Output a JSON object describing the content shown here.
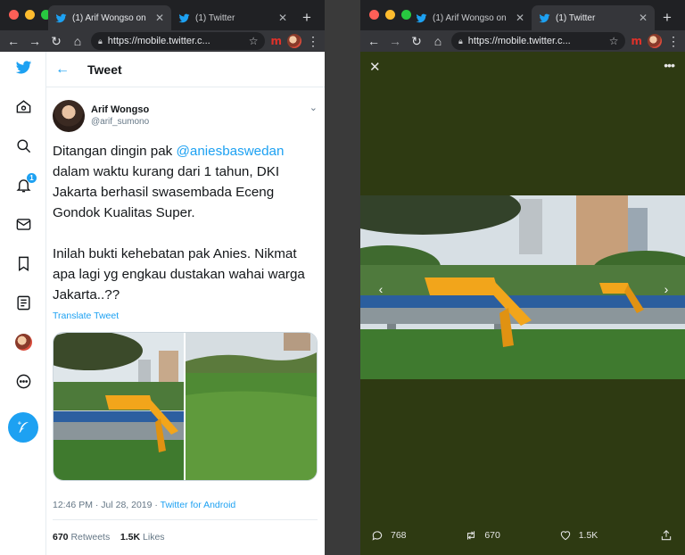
{
  "browser": {
    "tab1_title": "(1) Arif Wongso on",
    "tab2_title": "(1) Twitter",
    "url": "https://mobile.twitter.c..."
  },
  "colors": {
    "twitter_blue": "#1da1f2",
    "viewer_bg": "#2e3a12"
  },
  "left": {
    "header_title": "Tweet",
    "notification_count": "1",
    "author": {
      "name": "Arif Wongso",
      "handle": "@arif_sumono"
    },
    "body": {
      "p1_before": "Ditangan dingin pak ",
      "p1_mention": "@aniesbaswedan",
      "p1_after": " dalam waktu kurang dari 1 tahun, DKI Jakarta berhasil swasembada Eceng Gondok Kualitas Super.",
      "p2": "Inilah bukti kehebatan pak Anies. Nikmat apa lagi yg engkau dustakan wahai warga Jakarta..??"
    },
    "translate_label": "Translate Tweet",
    "timestamp": "12:46 PM · Jul 28, 2019 · ",
    "source": "Twitter for Android",
    "retweets_count": "670",
    "retweets_label": "Retweets",
    "likes_count": "1.5K",
    "likes_label": "Likes"
  },
  "right": {
    "replies": "768",
    "retweets": "670",
    "likes": "1.5K"
  }
}
